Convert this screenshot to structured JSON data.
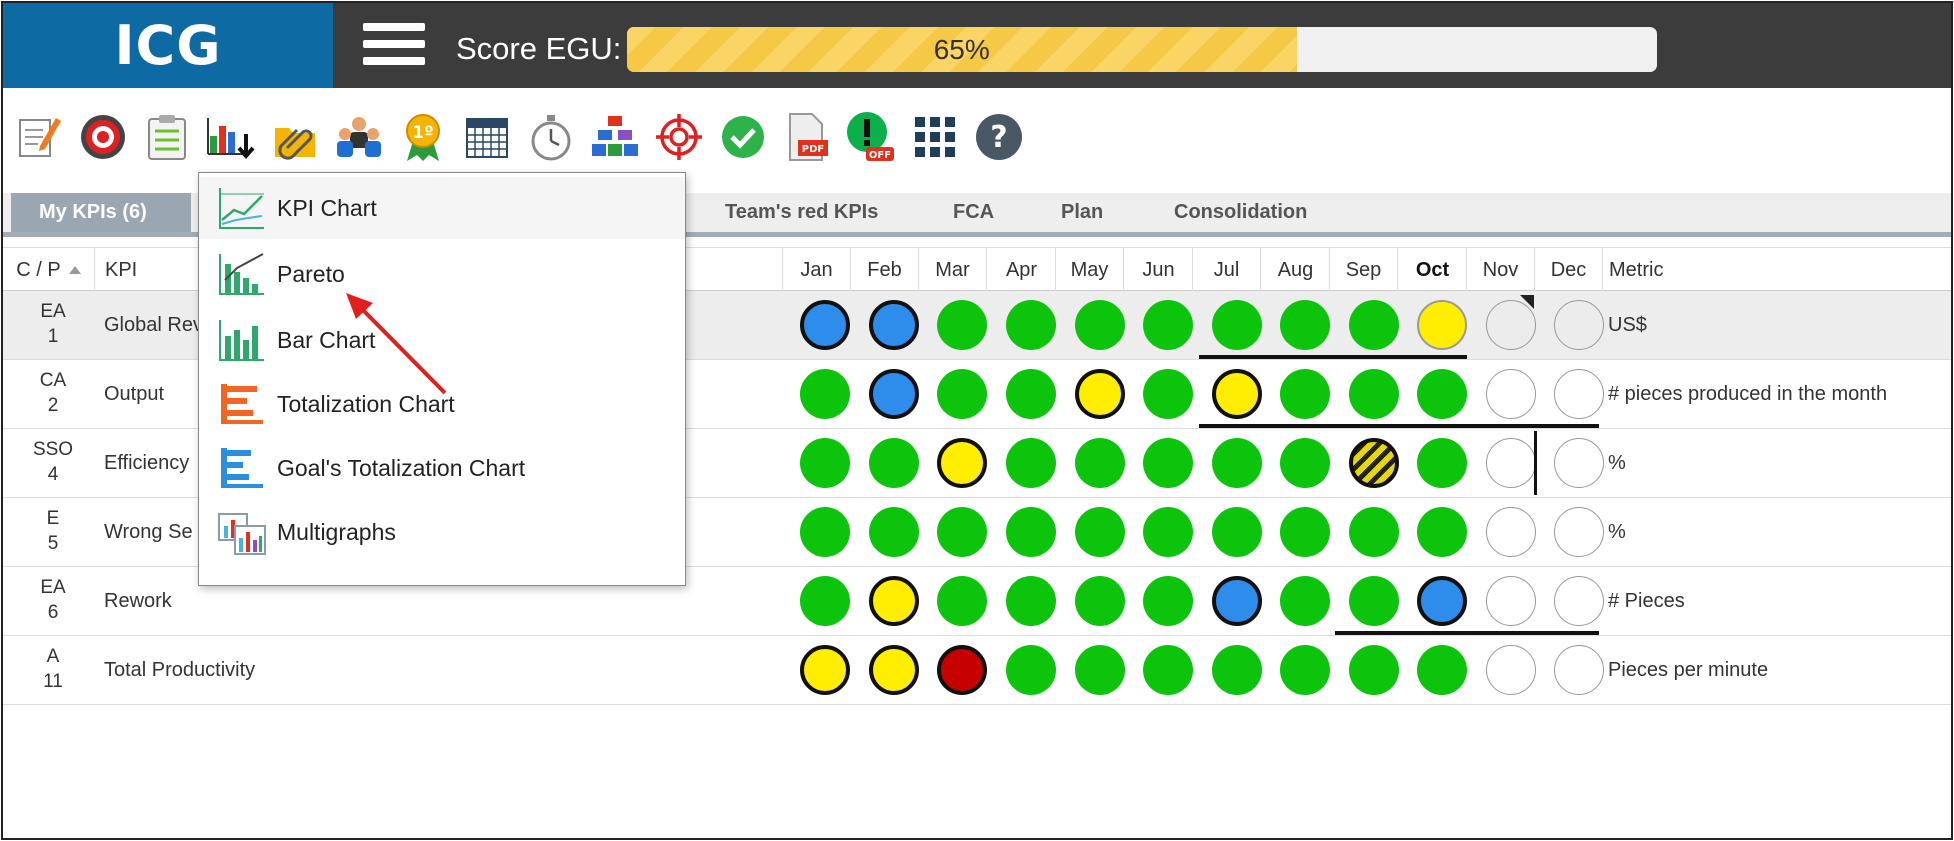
{
  "header": {
    "logo": "ICG",
    "score_label": "Score EGU:",
    "score_value": "65%",
    "score_fraction": 0.65
  },
  "toolbar": {
    "icons": [
      "edit-icon",
      "target-icon",
      "checklist-icon",
      "chart-download-icon",
      "attachment-icon",
      "team-icon",
      "award-icon",
      "calendar-icon",
      "stopwatch-icon",
      "org-chart-icon",
      "crosshair-icon",
      "check-icon",
      "pdf-icon",
      "alert-off-icon",
      "grid-icon",
      "help-icon"
    ],
    "pdf_text": "PDF",
    "off_text": "OFF",
    "award_text": "1º"
  },
  "tabs": [
    {
      "label": "My KPIs (6)",
      "active": true
    },
    {
      "label": "Team's red KPIs"
    },
    {
      "label": "FCA"
    },
    {
      "label": "Plan"
    },
    {
      "label": "Consolidation"
    }
  ],
  "table": {
    "headers": {
      "cp": "C / P",
      "kpi": "KPI",
      "months": [
        "Jan",
        "Feb",
        "Mar",
        "Apr",
        "May",
        "Jun",
        "Jul",
        "Aug",
        "Sep",
        "Oct",
        "Nov",
        "Dec"
      ],
      "current_month": "Oct",
      "metric": "Metric"
    },
    "rows": [
      {
        "cp1": "EA",
        "cp2": "1",
        "kpi": "Global Rev",
        "metric": "US$",
        "status": [
          "blue",
          "blue",
          "green",
          "green",
          "green",
          "green",
          "green",
          "green",
          "green",
          "yellow",
          "empty",
          "empty"
        ]
      },
      {
        "cp1": "CA",
        "cp2": "2",
        "kpi": "Output",
        "metric": "# pieces produced in the month",
        "status": [
          "green",
          "blue",
          "green",
          "green",
          "yellow",
          "green",
          "yellow",
          "green",
          "green",
          "green",
          "empty",
          "empty"
        ]
      },
      {
        "cp1": "SSO",
        "cp2": "4",
        "kpi": "Efficiency",
        "metric": "%",
        "status": [
          "green",
          "green",
          "yellow",
          "green",
          "green",
          "green",
          "green",
          "green",
          "hatched",
          "green",
          "empty",
          "empty"
        ]
      },
      {
        "cp1": "E",
        "cp2": "5",
        "kpi": "Wrong Se",
        "metric": "%",
        "status": [
          "green",
          "green",
          "green",
          "green",
          "green",
          "green",
          "green",
          "green",
          "green",
          "green",
          "empty",
          "empty"
        ]
      },
      {
        "cp1": "EA",
        "cp2": "6",
        "kpi": "Rework",
        "metric": "# Pieces",
        "status": [
          "green",
          "yellow",
          "green",
          "green",
          "green",
          "green",
          "blue",
          "green",
          "green",
          "blue",
          "empty",
          "empty"
        ]
      },
      {
        "cp1": "A",
        "cp2": "11",
        "kpi": "Total Productivity",
        "metric": "Pieces per minute",
        "status": [
          "yellow",
          "yellow",
          "red",
          "green",
          "green",
          "green",
          "green",
          "green",
          "green",
          "green",
          "empty",
          "empty"
        ]
      }
    ]
  },
  "dropdown": {
    "items": [
      {
        "label": "KPI Chart",
        "icon": "line-chart-icon"
      },
      {
        "label": "Pareto",
        "icon": "pareto-chart-icon"
      },
      {
        "label": "Bar Chart",
        "icon": "bar-chart-icon"
      },
      {
        "label": "Totalization Chart",
        "icon": "totalization-chart-icon"
      },
      {
        "label": "Goal's Totalization Chart",
        "icon": "goal-totalization-chart-icon"
      },
      {
        "label": "Multigraphs",
        "icon": "multigraphs-icon"
      }
    ]
  },
  "colors": {
    "header_bg": "#3c3c3c",
    "logo_bg": "#0e6aa3",
    "green": "#0dc40d",
    "blue": "#2e8dea",
    "yellow": "#ffee00",
    "red": "#c60000"
  }
}
